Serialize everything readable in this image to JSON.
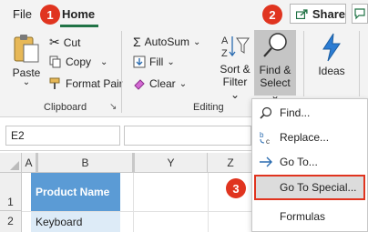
{
  "tabs": {
    "file": "File",
    "home": "Home"
  },
  "share_label": "Share",
  "badges": [
    "1",
    "2",
    "3"
  ],
  "ribbon": {
    "paste": "Paste",
    "cut": "Cut",
    "copy": "Copy",
    "format_painter": "Format Pair",
    "clipboard_group": "Clipboard",
    "autosum": "AutoSum",
    "fill": "Fill",
    "clear": "Clear",
    "sort_filter_1": "Sort &",
    "sort_filter_2": "Filter",
    "find_select_1": "Find &",
    "find_select_2": "Select",
    "editing_group": "Editing",
    "ideas": "Ideas"
  },
  "formula_bar": {
    "name_box": "E2"
  },
  "columns": [
    "A",
    "B",
    "Y",
    "Z"
  ],
  "rows": [
    "1",
    "2"
  ],
  "cells": {
    "b1": "Product Name",
    "b2": "Keyboard"
  },
  "menu": {
    "find": "Find...",
    "replace": "Replace...",
    "goto": "Go To...",
    "goto_special": "Go To Special...",
    "formulas": "Formulas"
  },
  "colors": {
    "accent": "#217346",
    "badge": "#e0341f",
    "header_fill": "#5b9bd5",
    "highlight_border": "#e0341f",
    "selected_bg": "#c5c5c5"
  }
}
